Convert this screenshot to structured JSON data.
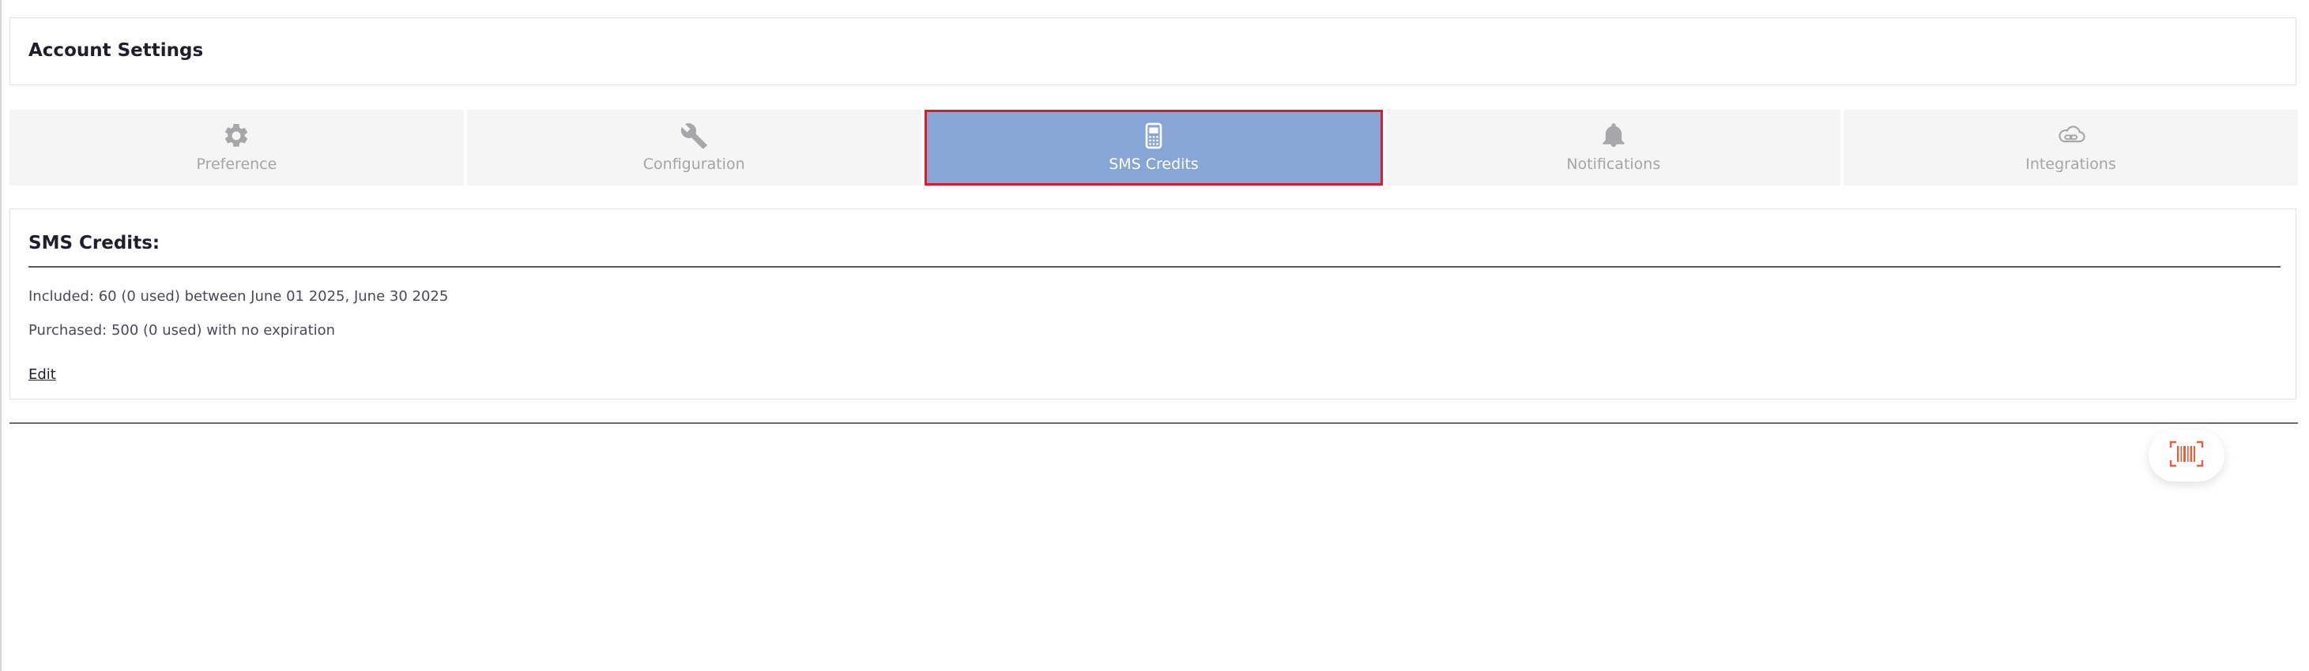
{
  "header": {
    "title": "Account Settings"
  },
  "tabs": [
    {
      "label": "Preference",
      "icon": "gear-icon",
      "active": false
    },
    {
      "label": "Configuration",
      "icon": "wrench-icon",
      "active": false
    },
    {
      "label": "SMS Credits",
      "icon": "phone-icon",
      "active": true
    },
    {
      "label": "Notifications",
      "icon": "bell-icon",
      "active": false
    },
    {
      "label": "Integrations",
      "icon": "cloud-link-icon",
      "active": false
    }
  ],
  "sms": {
    "title": "SMS Credits:",
    "included": "Included: 60 (0 used) between June 01 2025, June 30 2025",
    "purchased": "Purchased: 500 (0 used) with no expiration",
    "edit_label": "Edit"
  },
  "fab": {
    "icon": "barcode-scan-icon"
  },
  "colors": {
    "active_tab_bg": "#87a6d8",
    "active_tab_border": "#d91c2b",
    "inactive_tab_bg": "#f5f5f5",
    "fab_icon": "#e8603c"
  }
}
